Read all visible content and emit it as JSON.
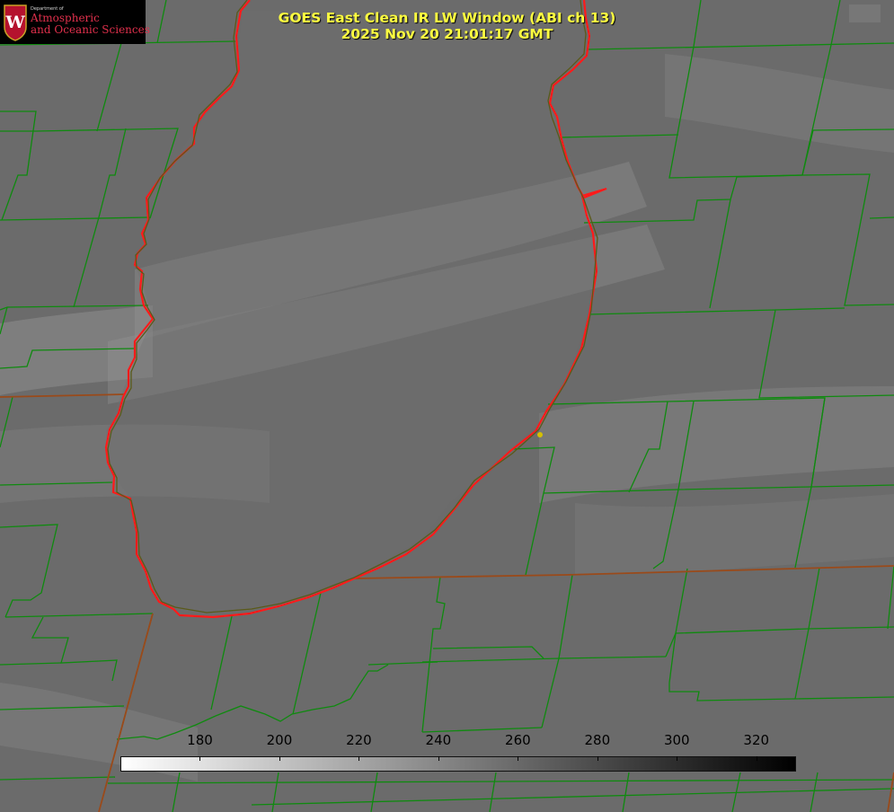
{
  "title": {
    "line1": "GOES East Clean IR LW Window (ABI ch 13)",
    "line2": "2025 Nov 20 21:01:17 GMT"
  },
  "logo": {
    "dept": "Department of",
    "line1": "Atmospheric",
    "line2": "and Oceanic Sciences",
    "crest_letter": "W",
    "crest_color": "#b5122e"
  },
  "colorbar": {
    "min": 160,
    "max": 330,
    "ticks": [
      "180",
      "200",
      "220",
      "240",
      "260",
      "280",
      "300",
      "320"
    ],
    "color_low": "#ffffff",
    "color_high": "#000000"
  },
  "colors": {
    "county_lines": "#0f8a0f",
    "coastline": "#ff1a1a",
    "state_lines": "#9a4a1a",
    "title_text": "#ffff40",
    "point_marker": "#d4c000"
  }
}
